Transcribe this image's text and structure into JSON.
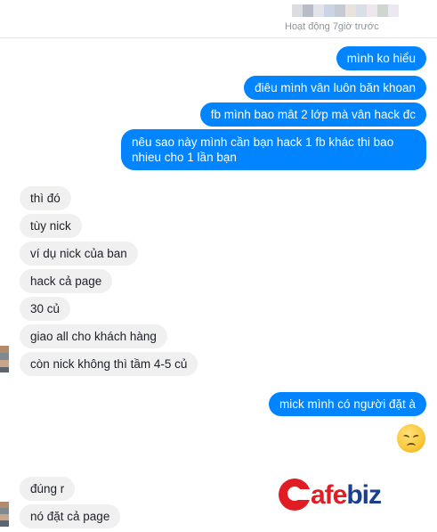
{
  "header": {
    "status": "Hoạt động 7giờ trước",
    "blur_colors": [
      "#dcdde0",
      "#c9d4e6",
      "#e8e3dc",
      "#b7bcc6",
      "#d9dfe8",
      "#f0e6ee",
      "#cfd6d2",
      "#e2e4ea",
      "#c6cad6",
      "#ece8f2",
      "#d6dbe6"
    ]
  },
  "messages": [
    {
      "dir": "out",
      "text": "mình ko hiểu"
    },
    {
      "dir": "out",
      "text": "điêu mình vân luôn băn khoan"
    },
    {
      "dir": "out",
      "text": "fb mình bao mât 2 lớp mà vân hack đc"
    },
    {
      "dir": "out",
      "text": "nêu sao này mình cần bạn hack 1 fb khác thi bao nhieu cho 1 lần bạn"
    },
    {
      "dir": "in",
      "text": "thì đó"
    },
    {
      "dir": "in",
      "text": "tùy nick"
    },
    {
      "dir": "in",
      "text": "ví dụ nick của ban"
    },
    {
      "dir": "in",
      "text": "hack cả page"
    },
    {
      "dir": "in",
      "text": "30 củ"
    },
    {
      "dir": "in",
      "text": "giao all cho khách hàng"
    },
    {
      "dir": "in",
      "text": "còn nick không thì tầm 4-5 củ"
    },
    {
      "dir": "out",
      "text": "mick mình có người đặt à"
    },
    {
      "dir": "in",
      "text": "đúng r"
    },
    {
      "dir": "in",
      "text": "nó đặt cả page"
    }
  ],
  "emoji": "disappointed-face-icon",
  "watermark": {
    "text": "CafeBiz",
    "part1": "afe",
    "part2": "biz"
  },
  "colors": {
    "outgoing": "#0084ff",
    "incoming": "#f1f0f0",
    "logo_red": "#e11c22",
    "logo_blue": "#1a3f8f"
  }
}
